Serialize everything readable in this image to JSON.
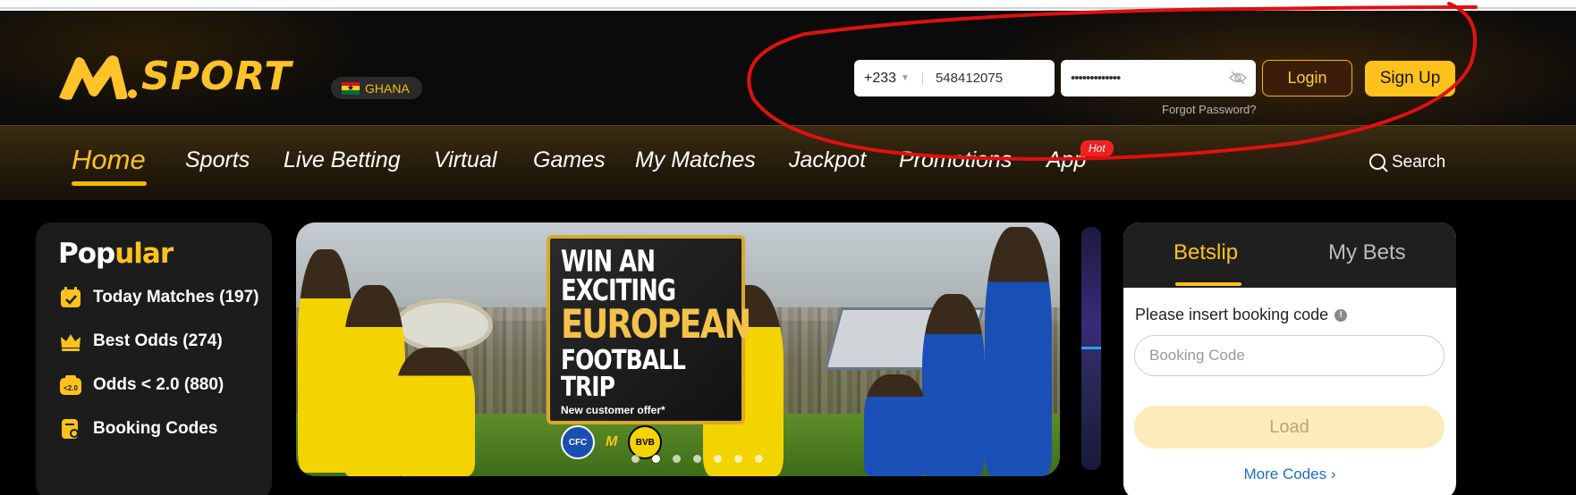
{
  "brand": {
    "logo_text": "SPORT",
    "country": "GHANA"
  },
  "login": {
    "country_code": "+233",
    "phone_value": "548412075",
    "password_mask": "•••••••••••••",
    "forgot_password": "Forgot Password?",
    "login_label": "Login",
    "signup_label": "Sign Up"
  },
  "nav": {
    "items": [
      "Home",
      "Sports",
      "Live Betting",
      "Virtual",
      "Games",
      "My Matches",
      "Jackpot",
      "Promotions",
      "App"
    ],
    "hot_badge": "Hot",
    "search_label": "Search"
  },
  "popular": {
    "title_white": "Pop",
    "title_yellow": "ular",
    "items": [
      {
        "label": "Today Matches (197)",
        "icon": "calendar-check-icon"
      },
      {
        "label": "Best Odds (274)",
        "icon": "crown-icon"
      },
      {
        "label": "Odds < 2.0 (880)",
        "icon": "odds-tag-icon",
        "icon_text": "<2.0"
      },
      {
        "label": "Booking Codes",
        "icon": "booking-code-icon"
      }
    ]
  },
  "banner": {
    "line1": "WIN AN EXCITING",
    "line2": "EUROPEAN",
    "line3": "FOOTBALL TRIP",
    "subtitle": "New customer offer*",
    "active_slide": 2,
    "slide_count": 7
  },
  "betslip": {
    "tab_active": "Betslip",
    "tab_inactive": "My Bets",
    "booking_label": "Please insert booking code",
    "booking_placeholder": "Booking Code",
    "load_label": "Load",
    "more_codes": "More Codes ›"
  },
  "colors": {
    "accent": "#ffc21c",
    "header_bg": "#0b0b0b",
    "annotation": "#e01010"
  }
}
